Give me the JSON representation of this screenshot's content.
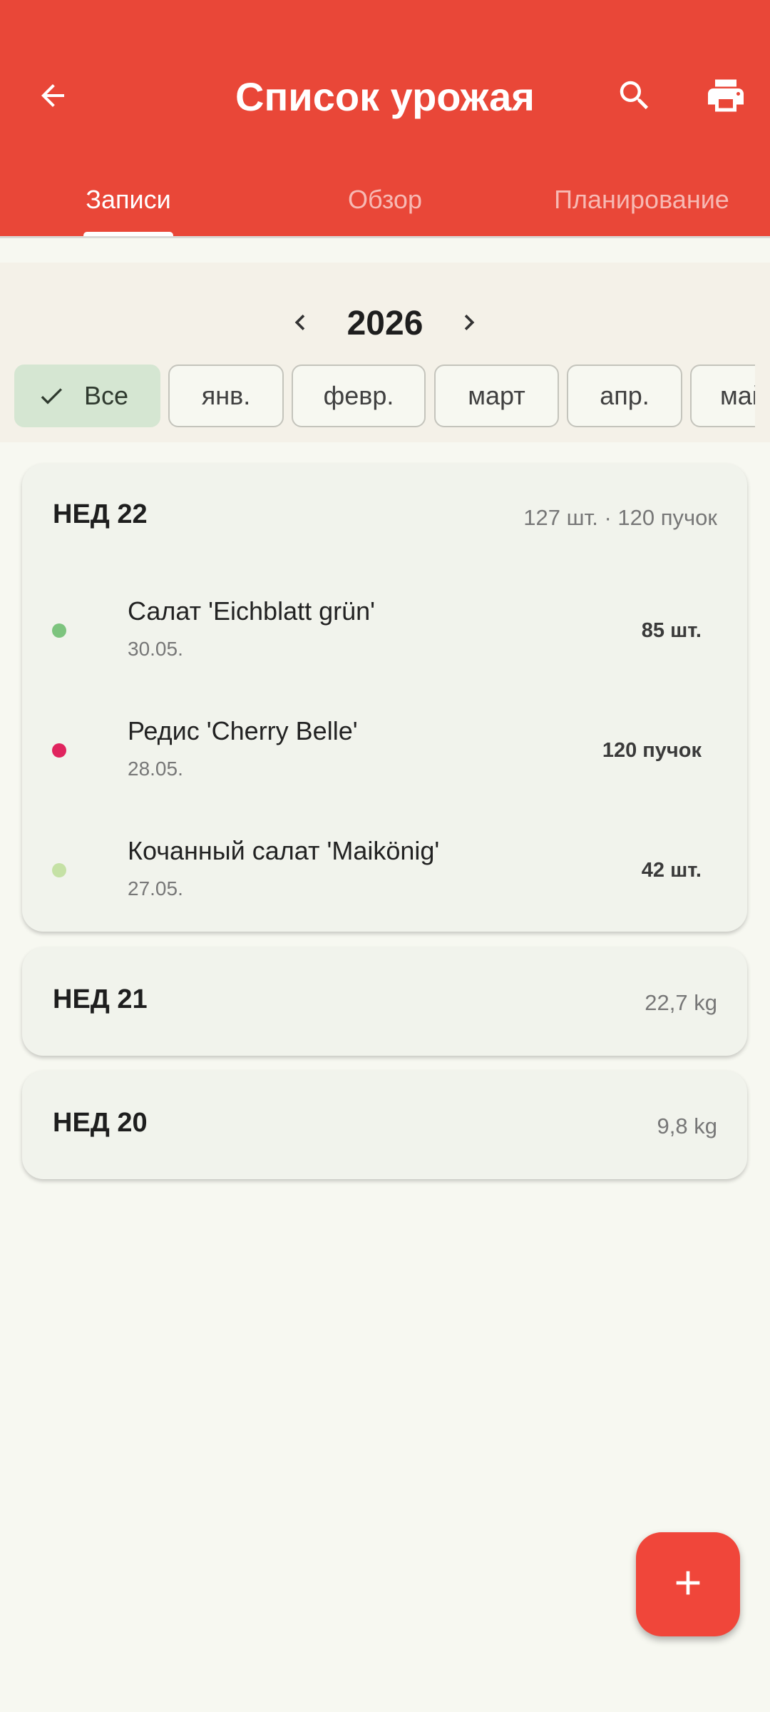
{
  "appbar": {
    "title": "Список урожая",
    "back_icon": "arrow-back-icon",
    "search_icon": "search-icon",
    "print_icon": "printer-icon",
    "color": "#E94738"
  },
  "tabs": [
    {
      "label": "Записи",
      "active": true
    },
    {
      "label": "Обзор",
      "active": false
    },
    {
      "label": "Планирование",
      "active": false
    }
  ],
  "filter": {
    "year": "2026",
    "chips": [
      {
        "label": "Все",
        "selected": true
      },
      {
        "label": "янв.",
        "selected": false
      },
      {
        "label": "февр.",
        "selected": false
      },
      {
        "label": "март",
        "selected": false
      },
      {
        "label": "апр.",
        "selected": false
      },
      {
        "label": "май",
        "selected": false
      }
    ]
  },
  "weeks": [
    {
      "title": "НЕД 22",
      "summary": "127 шт. · 120 пучок",
      "expanded": true,
      "entries": [
        {
          "name": "Салат 'Eichblatt grün'",
          "date": "30.05.",
          "quantity": "85 шт.",
          "color": "#7DC47E"
        },
        {
          "name": "Редис 'Cherry Belle'",
          "date": "28.05.",
          "quantity": "120 пучок",
          "color": "#E0245E"
        },
        {
          "name": "Кочанный салат 'Maikönig'",
          "date": "27.05.",
          "quantity": "42 шт.",
          "color": "#C5E1A5"
        }
      ]
    },
    {
      "title": "НЕД 21",
      "summary": "22,7 kg",
      "expanded": false
    },
    {
      "title": "НЕД 20",
      "summary": "9,8 kg",
      "expanded": false
    }
  ],
  "fab": {
    "icon": "plus-icon",
    "color": "#F0463A"
  }
}
